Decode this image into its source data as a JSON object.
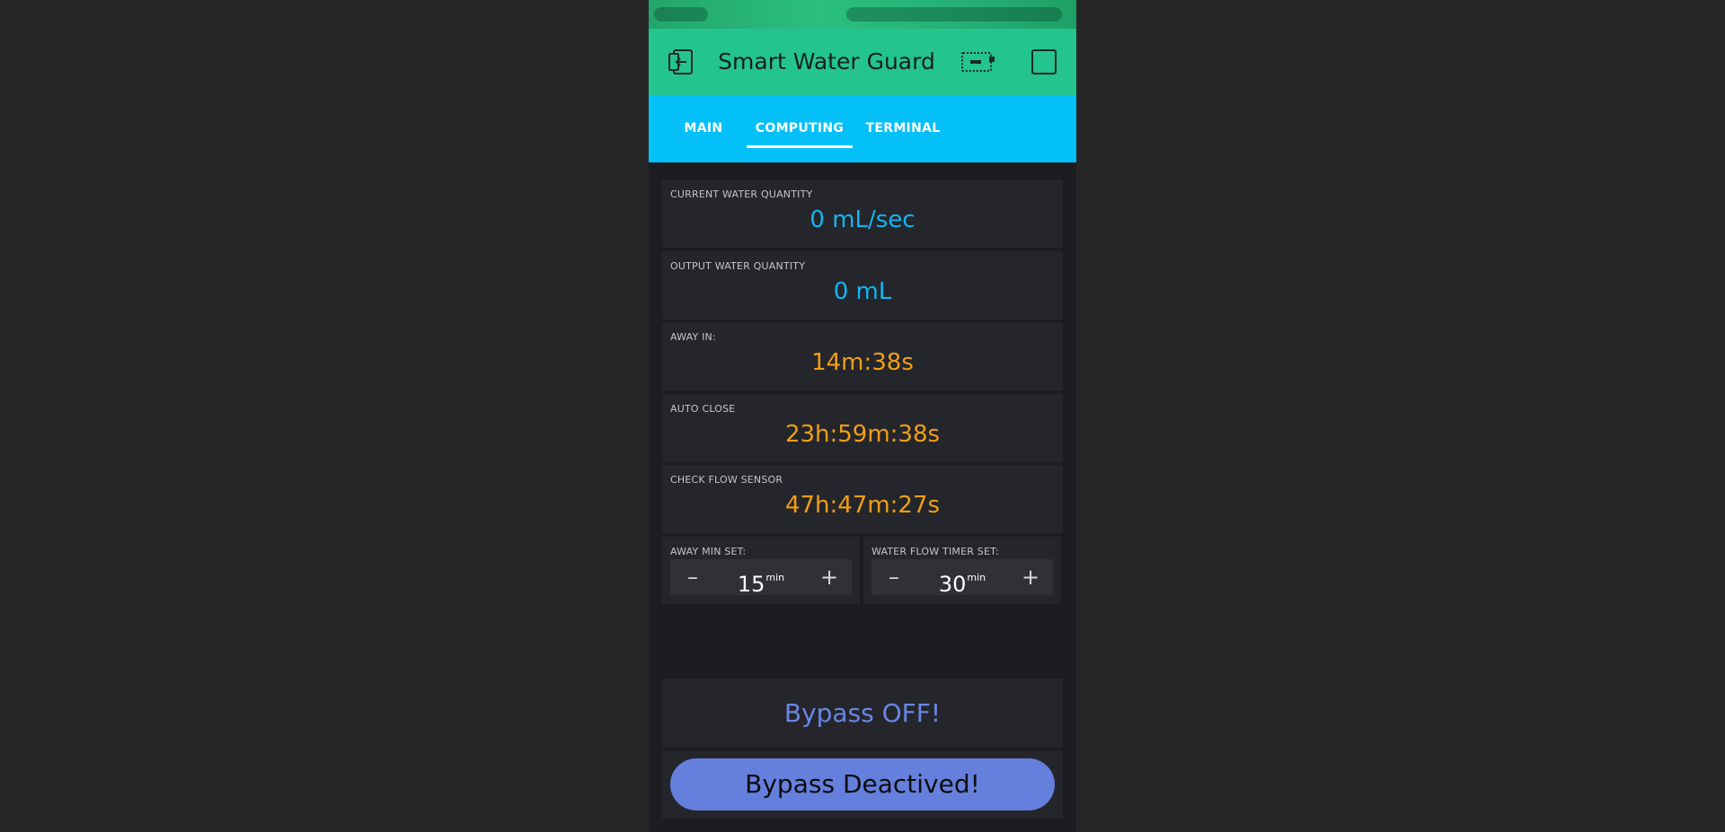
{
  "app": {
    "title": "Smart Water Guard"
  },
  "header_icons": {
    "left": "exit-icon",
    "device": "device-icon",
    "right": "square-icon"
  },
  "tabs": [
    {
      "label": "MAIN",
      "active": false
    },
    {
      "label": "COMPUTING",
      "active": true
    },
    {
      "label": "TERMINAL",
      "active": false
    }
  ],
  "cards": [
    {
      "label": "CURRENT WATER QUANTITY",
      "value": "0 mL/sec",
      "color": "#12b6f2"
    },
    {
      "label": "OUTPUT WATER QUANTITY",
      "value": "0 mL",
      "color": "#12b6f2"
    },
    {
      "label": "AWAY IN:",
      "value": "14m:38s",
      "color": "#f09e17"
    },
    {
      "label": "AUTO CLOSE",
      "value": "23h:59m:38s",
      "color": "#f09e17"
    },
    {
      "label": "CHECK FLOW SENSOR",
      "value": "47h:47m:27s",
      "color": "#f09e17"
    }
  ],
  "steppers": [
    {
      "label": "AWAY MIN SET:",
      "value": "15",
      "unit": "min",
      "minus": "–",
      "plus": "+"
    },
    {
      "label": "WATER FLOW TIMER SET:",
      "value": "30",
      "unit": "min",
      "minus": "–",
      "plus": "+"
    }
  ],
  "bypass": {
    "status": "Bypass OFF!",
    "button_label": "Bypass Deactived!"
  },
  "colors": {
    "header": "#24c48e",
    "tabs": "#04c0f8",
    "accent_button": "#6580dc",
    "status_text": "#6a86e6"
  }
}
